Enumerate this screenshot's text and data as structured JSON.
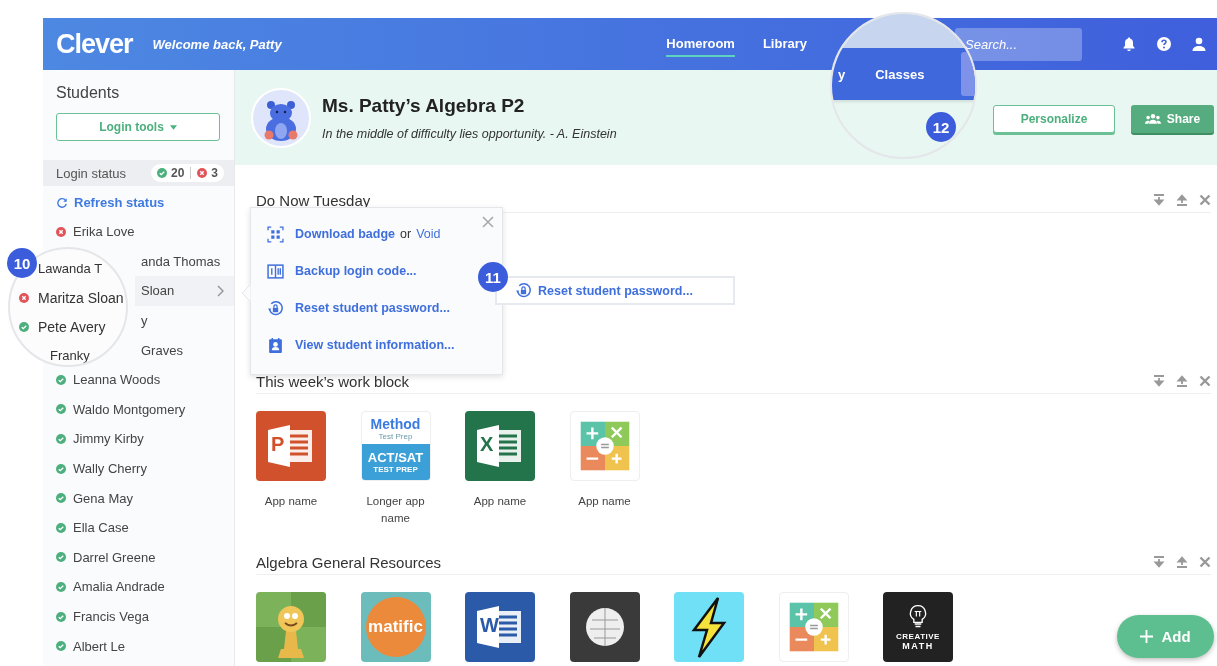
{
  "header": {
    "logo": "Clever",
    "welcome": "Welcome back, Patty",
    "nav": [
      {
        "label": "Homeroom",
        "selected": true
      },
      {
        "label": "Library",
        "selected": false
      }
    ],
    "search": {
      "placeholder": "Search..."
    }
  },
  "sidebar": {
    "title": "Students",
    "login_tools": "Login tools",
    "login_status": {
      "label": "Login status",
      "ok_count": "20",
      "error_count": "3"
    },
    "refresh": "Refresh status",
    "students": [
      {
        "name": "Erika Love",
        "kind": "student",
        "logged_in": false,
        "selected": false
      },
      {
        "name": "anda Thomas",
        "kind": "covered",
        "selected": false
      },
      {
        "name": "Sloan",
        "kind": "covered",
        "selected": true
      },
      {
        "name": "y",
        "kind": "covered",
        "selected": false
      },
      {
        "name": "Graves",
        "kind": "covered",
        "selected": false
      },
      {
        "name": "Leanna Woods",
        "kind": "student",
        "logged_in": true,
        "selected": false
      },
      {
        "name": "Waldo Montgomery",
        "kind": "student",
        "logged_in": true,
        "selected": false
      },
      {
        "name": "Jimmy Kirby",
        "kind": "student",
        "logged_in": true,
        "selected": false
      },
      {
        "name": "Wally Cherry",
        "kind": "student",
        "logged_in": true,
        "selected": false
      },
      {
        "name": "Gena May",
        "kind": "student",
        "logged_in": true,
        "selected": false
      },
      {
        "name": "Ella Case",
        "kind": "student",
        "logged_in": true,
        "selected": false
      },
      {
        "name": "Darrel Greene",
        "kind": "student",
        "logged_in": true,
        "selected": false
      },
      {
        "name": "Amalia Andrade",
        "kind": "student",
        "logged_in": true,
        "selected": false
      },
      {
        "name": "Francis Vega",
        "kind": "student",
        "logged_in": true,
        "selected": false
      },
      {
        "name": "Albert Le",
        "kind": "student",
        "logged_in": true,
        "selected": false
      }
    ]
  },
  "student_magnifier": {
    "number": "10",
    "rows": [
      {
        "name": "Lawanda T"
      },
      {
        "name": "Maritza Sloan",
        "logged_in": false
      },
      {
        "name": "Pete Avery",
        "logged_in": true
      },
      {
        "name": "Franky"
      }
    ]
  },
  "nav_magnifier": {
    "number": "12",
    "partial_label": "y",
    "label": "Classes"
  },
  "class_header": {
    "title": "Ms. Patty’s Algebra P2",
    "quote": "In the middle of difficulty lies opportunity. - A. Einstein",
    "buttons": [
      {
        "label": "Personalize",
        "kind": "outline"
      },
      {
        "label": "Share",
        "kind": "primary"
      }
    ]
  },
  "sections": [
    {
      "title": "Do Now Tuesday"
    },
    {
      "title": "This week’s work block",
      "apps": [
        {
          "name": "App name",
          "kind": "powerpoint",
          "logo_text": [
            "P"
          ]
        },
        {
          "name": "Longer app name",
          "kind": "method",
          "logo_text": [
            "Method",
            "Test Prep",
            "ACT/SAT",
            "TEST PREP"
          ]
        },
        {
          "name": "App name",
          "kind": "excel",
          "logo_text": [
            "X"
          ]
        },
        {
          "name": "App name",
          "kind": "mathops"
        }
      ]
    },
    {
      "title": "Algebra General Resources",
      "apps": [
        {
          "kind": "chess"
        },
        {
          "kind": "matific",
          "logo_text": [
            "matific"
          ]
        },
        {
          "kind": "word",
          "logo_text": [
            "W"
          ]
        },
        {
          "kind": "globe"
        },
        {
          "kind": "bolt"
        },
        {
          "kind": "mathops"
        },
        {
          "kind": "creative-math",
          "logo_text": [
            "CREATIVE",
            "MATH"
          ]
        }
      ]
    }
  ],
  "popover": {
    "items": [
      {
        "kind": "badge",
        "label": "Download badge",
        "connector": "or",
        "link": "Void"
      },
      {
        "kind": "code",
        "label": "Backup login code..."
      },
      {
        "kind": "reset",
        "label": "Reset student password..."
      },
      {
        "kind": "info",
        "label": "View student information..."
      }
    ]
  },
  "callout": {
    "number": "11",
    "label": "Reset student password..."
  },
  "add_button": "Add"
}
